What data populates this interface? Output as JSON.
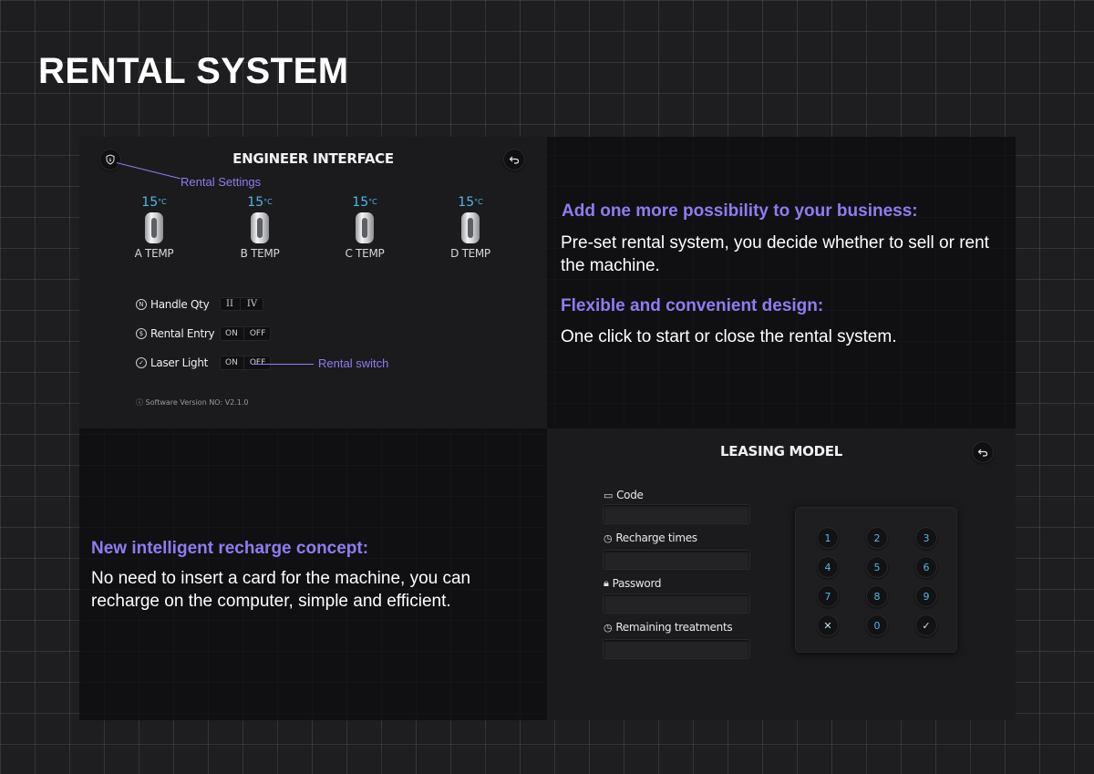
{
  "page_title": "RENTAL SYSTEM",
  "engineer": {
    "title": "ENGINEER INTERFACE",
    "settings_icon": "rental-settings-icon",
    "back_icon": "back-arrow-icon",
    "temps": [
      {
        "value": "15",
        "unit": "°C",
        "label": "A TEMP"
      },
      {
        "value": "15",
        "unit": "°C",
        "label": "B TEMP"
      },
      {
        "value": "15",
        "unit": "°C",
        "label": "C TEMP"
      },
      {
        "value": "15",
        "unit": "°C",
        "label": "D TEMP"
      }
    ],
    "handle_qty": {
      "label": "Handle Qty",
      "options": [
        "II",
        "IV"
      ]
    },
    "rental_entry": {
      "label": "Rental Entry",
      "on": "ON",
      "off": "OFF"
    },
    "laser_light": {
      "label": "Laser Light",
      "on": "ON",
      "off": "OFF"
    },
    "version": "Software Version NO: V2.1.0"
  },
  "callouts": {
    "rental_settings": "Rental Settings",
    "rental_switch": "Rental switch"
  },
  "blocks": {
    "b1_heading": "Add one more possibility to your business:",
    "b1_text": "Pre-set rental system, you decide whether to sell or rent the machine.",
    "b2_heading": "Flexible and convenient design:",
    "b2_text": "One click to start or close the rental system.",
    "b3_heading": "New intelligent recharge concept:",
    "b3_text": "No need to insert a card for the machine, you can recharge on the computer, simple and efficient."
  },
  "leasing": {
    "title": "LEASING MODEL",
    "fields": [
      {
        "label": "Code",
        "icon": "monitor-icon"
      },
      {
        "label": "Recharge times",
        "icon": "clock-icon"
      },
      {
        "label": "Password",
        "icon": "lock-icon"
      },
      {
        "label": "Remaining treatments",
        "icon": "clock-icon"
      }
    ],
    "keys": [
      "1",
      "2",
      "3",
      "4",
      "5",
      "6",
      "7",
      "8",
      "9",
      "✕",
      "0",
      "✓"
    ]
  }
}
